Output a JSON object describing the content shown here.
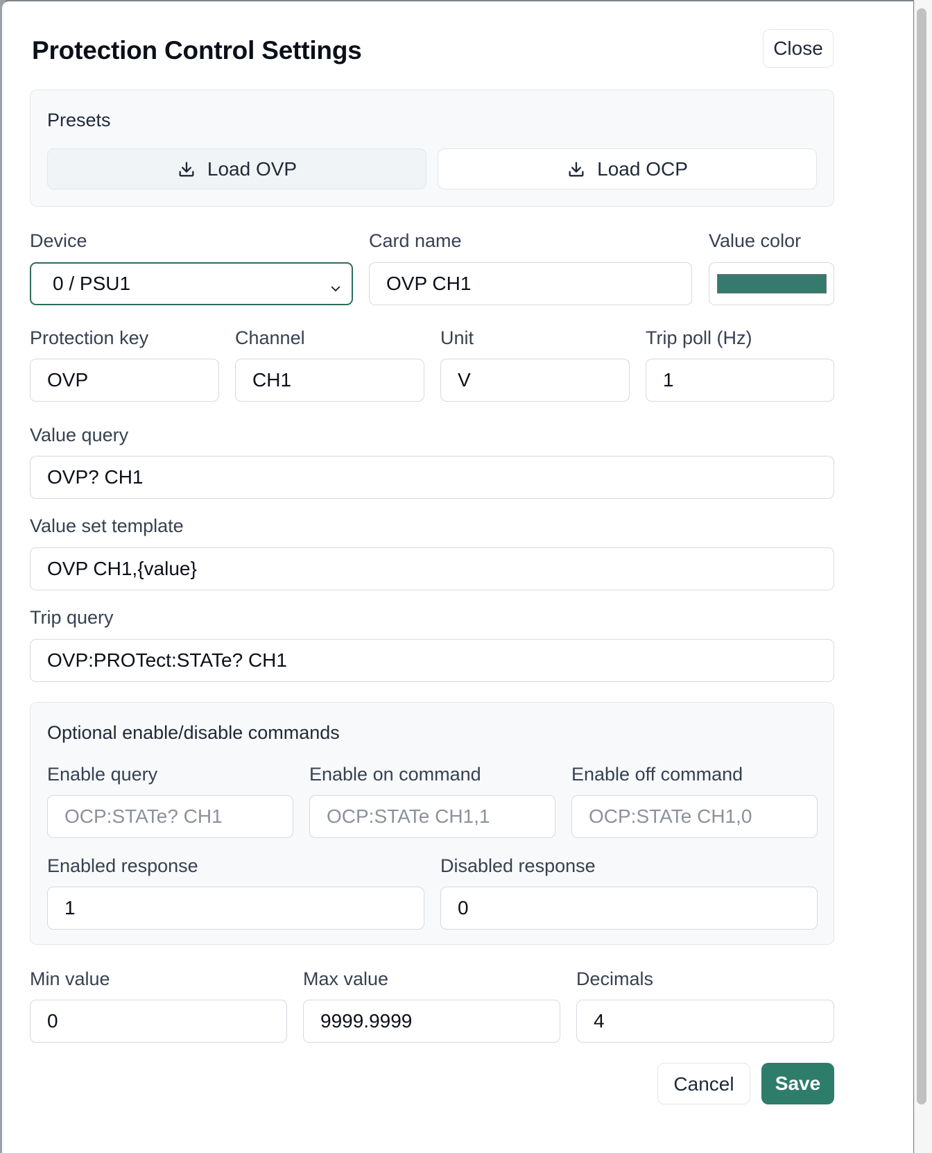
{
  "dialog": {
    "title": "Protection Control Settings",
    "close_label": "Close"
  },
  "presets": {
    "title": "Presets",
    "load_ovp_label": "Load OVP",
    "load_ocp_label": "Load OCP",
    "icon": "download-icon"
  },
  "fields": {
    "device": {
      "label": "Device",
      "value": "0 / PSU1"
    },
    "card_name": {
      "label": "Card name",
      "value": "OVP CH1"
    },
    "value_color": {
      "label": "Value color",
      "value": "#357a6d"
    },
    "protection_key": {
      "label": "Protection key",
      "value": "OVP"
    },
    "channel": {
      "label": "Channel",
      "value": "CH1"
    },
    "unit": {
      "label": "Unit",
      "value": "V"
    },
    "trip_poll": {
      "label": "Trip poll (Hz)",
      "value": "1"
    },
    "value_query": {
      "label": "Value query",
      "value": "OVP? CH1"
    },
    "value_set_template": {
      "label": "Value set template",
      "value": "OVP CH1,{value}"
    },
    "trip_query": {
      "label": "Trip query",
      "value": "OVP:PROTect:STATe? CH1"
    }
  },
  "optional": {
    "title": "Optional enable/disable commands",
    "enable_query": {
      "label": "Enable query",
      "placeholder": "OCP:STATe? CH1"
    },
    "enable_on": {
      "label": "Enable on command",
      "placeholder": "OCP:STATe CH1,1"
    },
    "enable_off": {
      "label": "Enable off command",
      "placeholder": "OCP:STATe CH1,0"
    },
    "enabled_response": {
      "label": "Enabled response",
      "value": "1"
    },
    "disabled_response": {
      "label": "Disabled response",
      "value": "0"
    }
  },
  "limits": {
    "min": {
      "label": "Min value",
      "value": "0"
    },
    "max": {
      "label": "Max value",
      "value": "9999.9999"
    },
    "decimals": {
      "label": "Decimals",
      "value": "4"
    }
  },
  "footer": {
    "cancel_label": "Cancel",
    "save_label": "Save"
  },
  "colors": {
    "accent": "#2e7d6b",
    "panel_bg": "#f7f9fb",
    "border": "#d5dae0"
  }
}
